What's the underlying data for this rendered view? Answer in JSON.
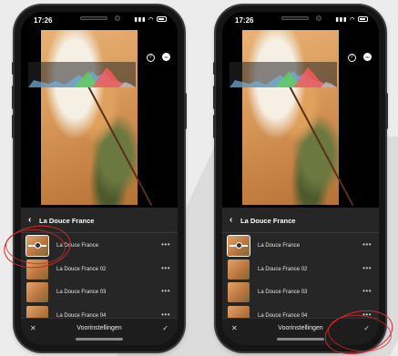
{
  "phones": [
    {
      "status": {
        "time": "17:26"
      },
      "panel": {
        "title": "La Douce France"
      },
      "presets": [
        {
          "label": "La Douce France",
          "selected": true
        },
        {
          "label": "La Douce France 02",
          "selected": false
        },
        {
          "label": "La Douce France 03",
          "selected": false
        },
        {
          "label": "La Douce France 04",
          "selected": false
        }
      ],
      "more_glyph": "•••",
      "bottom_bar": {
        "title": "Voorinstellingen",
        "cancel_glyph": "✕",
        "confirm_glyph": "✓"
      },
      "icons": {
        "help": "?",
        "more": "•••"
      }
    },
    {
      "status": {
        "time": "17:26"
      },
      "panel": {
        "title": "La Douce France"
      },
      "presets": [
        {
          "label": "La Douce France",
          "selected": true
        },
        {
          "label": "La Douce France 02",
          "selected": false
        },
        {
          "label": "La Douce France 03",
          "selected": false
        },
        {
          "label": "La Douce France 04",
          "selected": false
        }
      ],
      "more_glyph": "•••",
      "bottom_bar": {
        "title": "Voorinstellingen",
        "cancel_glyph": "✕",
        "confirm_glyph": "✓"
      },
      "icons": {
        "help": "?",
        "more": "•••"
      }
    }
  ],
  "annotation_color": "#d62828"
}
